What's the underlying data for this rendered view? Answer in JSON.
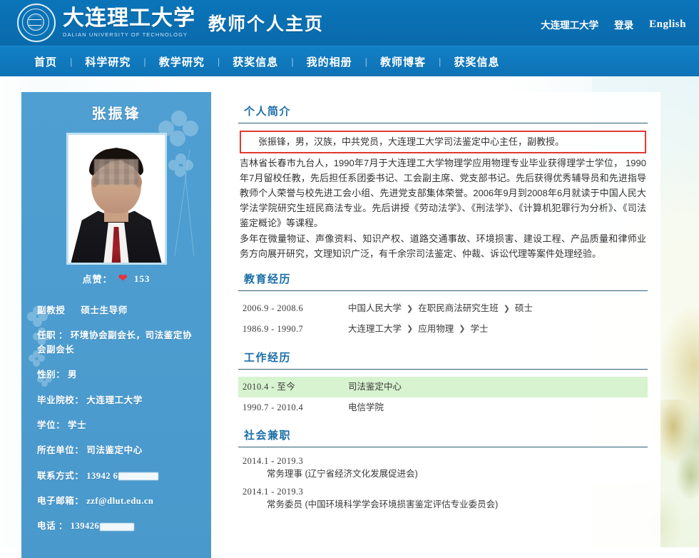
{
  "header": {
    "logo_icon": "dut-seal-logo-icon",
    "brand_cn": "大连理工大学",
    "brand_en": "DALIAN UNIVERSITY OF TECHNOLOGY",
    "brand_sub": "教师个人主页",
    "links": [
      {
        "label": "大连理工大学",
        "name": "header-link-university"
      },
      {
        "label": "登录",
        "name": "header-link-login"
      },
      {
        "label": "English",
        "name": "header-link-english"
      }
    ]
  },
  "nav": {
    "separator": "|",
    "items": [
      {
        "label": "首页"
      },
      {
        "label": "科学研究"
      },
      {
        "label": "教学研究"
      },
      {
        "label": "获奖信息"
      },
      {
        "label": "我的相册"
      },
      {
        "label": "教师博客"
      },
      {
        "label": "获奖信息"
      }
    ]
  },
  "sidebar": {
    "name": "张振锋",
    "photo_alt": "张振锋 证件照",
    "like_label": "点赞：",
    "like_icon": "heart-icon",
    "like_count": "153",
    "titles": [
      "副教授",
      "硕士生导师"
    ],
    "fields": [
      {
        "label": "任职 ：",
        "value": "环境协会副会长，司法鉴定协会副会长",
        "redacted": false
      },
      {
        "label": "性别：",
        "value": "男",
        "redacted": false
      },
      {
        "label": "毕业院校：",
        "value": "大连理工大学",
        "redacted": false
      },
      {
        "label": "学位：",
        "value": "学士",
        "redacted": false
      },
      {
        "label": "所在单位：",
        "value": "司法鉴定中心",
        "redacted": false
      },
      {
        "label": "联系方式：",
        "value": "13942 6",
        "redacted": true
      },
      {
        "label": "电子邮箱：",
        "value": "zzf@dlut.edu.cn",
        "redacted": false
      },
      {
        "label": "电话 ：",
        "value": "139426",
        "redacted": true
      }
    ]
  },
  "main": {
    "sections": {
      "bio": {
        "title": "个人简介",
        "highlight": "张振锋，男，汉族，中共党员，大连理工大学司法鉴定中心主任，副教授。",
        "paragraphs": [
          "吉林省长春市九台人，1990年7月于大连理工大学物理学应用物理专业毕业获得理学士学位， 1990年7月留校任教，先后担任系团委书记、工会副主席、党支部书记。先后获得优秀辅导员和先进指导教师个人荣誉与校先进工会小组、先进党支部集体荣誉。2006年9月到2008年6月就读于中国人民大学法学院研究生班民商法专业。先后讲授《劳动法学》、《刑法学》、《计算机犯罪行为分析》、《司法鉴定概论》等课程。",
          "多年在微量物证、声像资料、知识产权、道路交通事故、环境损害、建设工程、产品质量和律师业务方向展开研究，文理知识广泛，有千余宗司法鉴定、仲裁、诉讼代理等案件处理经验。"
        ]
      },
      "education": {
        "title": "教育经历",
        "rows": [
          {
            "date": "2006.9 - 2008.6",
            "parts": [
              "中国人民大学",
              "在职民商法研究生班",
              "硕士"
            ],
            "highlight": false
          },
          {
            "date": "1986.9 - 1990.7",
            "parts": [
              "大连理工大学",
              "应用物理",
              "学士"
            ],
            "highlight": false
          }
        ]
      },
      "work": {
        "title": "工作经历",
        "rows": [
          {
            "date": "2010.4 - 至今",
            "parts": [
              "司法鉴定中心"
            ],
            "highlight": true
          },
          {
            "date": "1990.7 - 2010.4",
            "parts": [
              "电信学院"
            ],
            "highlight": false
          }
        ]
      },
      "social": {
        "title": "社会兼职",
        "items": [
          {
            "date": "2014.1 - 2019.3",
            "desc": "常务理事 (辽宁省经济文化发展促进会)"
          },
          {
            "date": "2014.1 - 2019.3",
            "desc": "常务委员 (中国环境科学学会环境损害鉴定评估专业委员会)"
          }
        ]
      }
    },
    "chevron": "❯"
  },
  "colors": {
    "header_blue": "#0b74b8",
    "nav_blue": "#1078bd",
    "sidebar_blue": "#4c9ccf",
    "section_title": "#1a6fa8",
    "rule": "#2d5f72",
    "highlight_border": "#e03a2f",
    "row_highlight": "#d7f3cf",
    "heart_red": "#e8323c"
  }
}
